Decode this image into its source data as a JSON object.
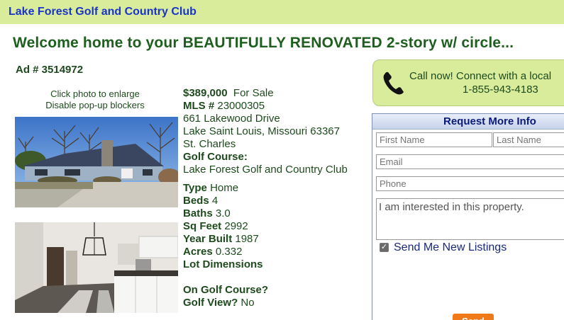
{
  "topbar": {
    "site_name": "Lake Forest Golf and Country Club"
  },
  "listing": {
    "headline": "Welcome home to your BEAUTIFULLY RENOVATED 2-story w/ circle...",
    "ad_number": "Ad # 3514972",
    "photo_hint_1": "Click photo to enlarge",
    "photo_hint_2": "Disable pop-up blockers",
    "price": "$389,000",
    "status": "For Sale",
    "mls_label": "MLS #",
    "mls": "23000305",
    "address": "661 Lakewood Drive",
    "city_state_zip": "Lake Saint Louis, Missouri 63367",
    "county": "St. Charles",
    "golf_course_label": "Golf Course:",
    "golf_course": "Lake Forest Golf and Country Club",
    "type_label": "Type",
    "type": "Home",
    "beds_label": "Beds",
    "beds": "4",
    "baths_label": "Baths",
    "baths": "3.0",
    "sqft_label": "Sq Feet",
    "sqft": "2992",
    "year_label": "Year Built",
    "year": "1987",
    "acres_label": "Acres",
    "acres": "0.332",
    "lot_label": "Lot Dimensions",
    "on_golf_label": "On Golf Course?",
    "golf_view_label": "Golf View?",
    "golf_view": "No"
  },
  "call": {
    "line1": "Call now! Connect with a local",
    "phone": "1-855-943-4183",
    "icon": "phone-icon"
  },
  "form": {
    "title": "Request More Info",
    "first_name_placeholder": "First Name",
    "last_name_placeholder": "Last Name",
    "email_placeholder": "Email",
    "phone_placeholder": "Phone",
    "message": "I am interested in this property.",
    "checkbox_label": "Send Me New Listings",
    "checkbox_checked": true,
    "send_label": "Send"
  },
  "colors": {
    "topbar_bg": "#d8ec9c",
    "title_link": "#1a34c8",
    "headline": "#1e5e1e",
    "send_button": "#f07a1a"
  }
}
